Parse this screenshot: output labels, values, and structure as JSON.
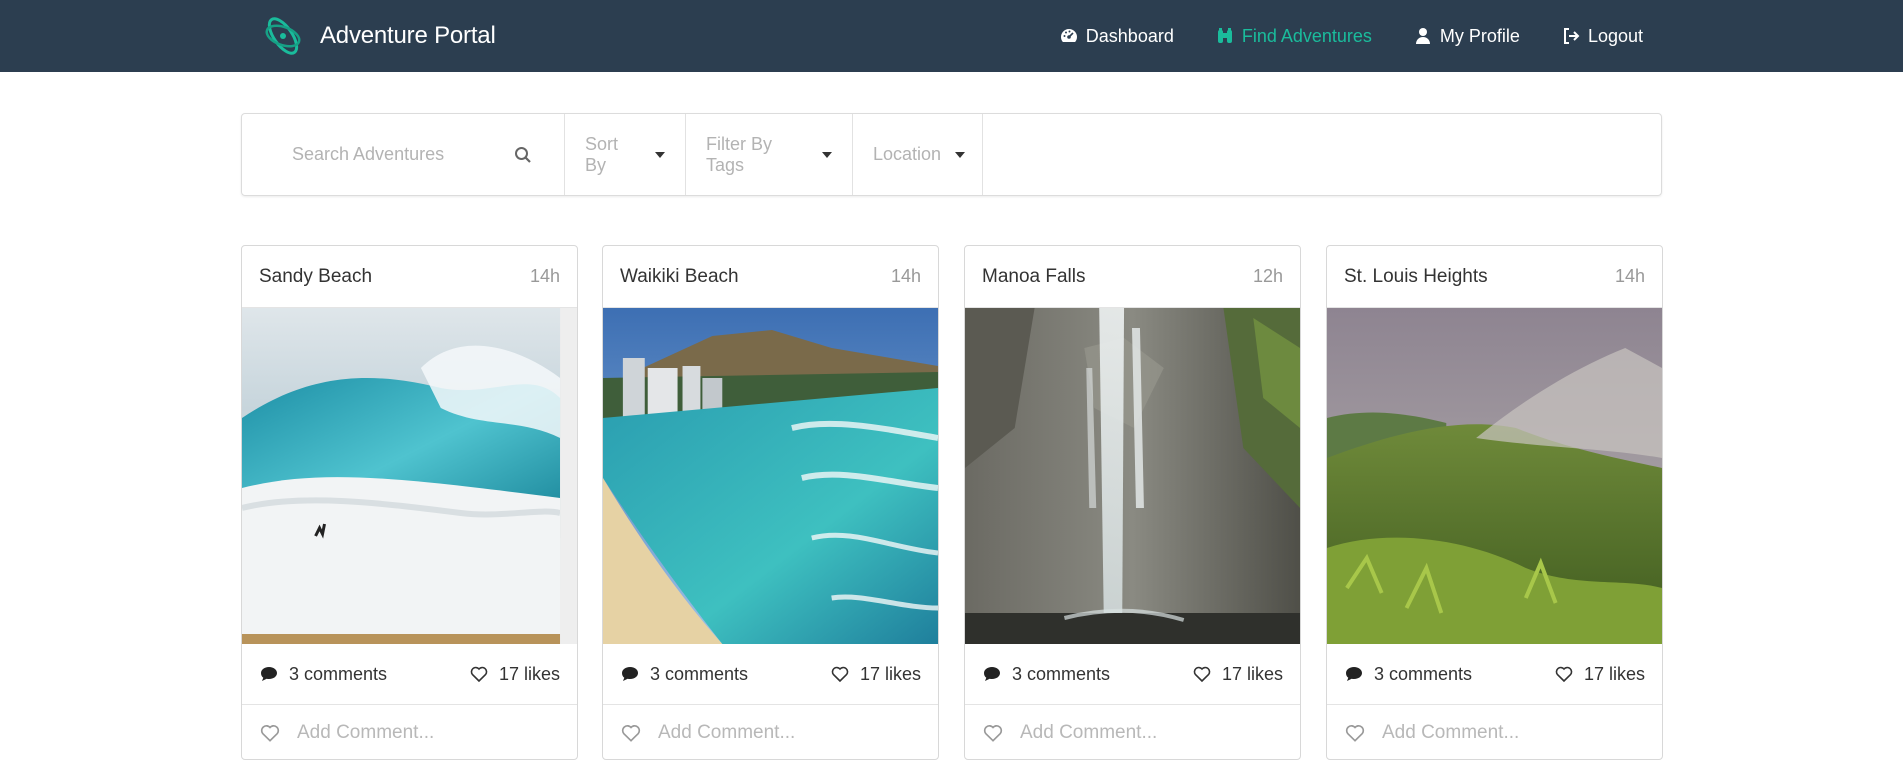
{
  "brand": {
    "name": "Adventure Portal",
    "logo_icon": "orbit-logo-icon",
    "accent": "#1abc9c"
  },
  "colors": {
    "navbar": "#2c3e50",
    "active": "#1abc9c"
  },
  "nav": [
    {
      "label": "Dashboard",
      "icon": "dashboard-icon",
      "active": false
    },
    {
      "label": "Find Adventures",
      "icon": "binoculars-icon",
      "active": true
    },
    {
      "label": "My Profile",
      "icon": "user-icon",
      "active": false
    },
    {
      "label": "Logout",
      "icon": "logout-icon",
      "active": false
    }
  ],
  "filters": {
    "search_placeholder": "Search Adventures",
    "sort_label": "Sort By",
    "tags_label": "Filter By Tags",
    "location_label": "Location"
  },
  "cards": [
    {
      "title": "Sandy Beach",
      "time": "14h",
      "comments": "3 comments",
      "likes": "17 likes",
      "comment_placeholder": "Add Comment..."
    },
    {
      "title": "Waikiki Beach",
      "time": "14h",
      "comments": "3 comments",
      "likes": "17 likes",
      "comment_placeholder": "Add Comment..."
    },
    {
      "title": "Manoa Falls",
      "time": "12h",
      "comments": "3 comments",
      "likes": "17 likes",
      "comment_placeholder": "Add Comment..."
    },
    {
      "title": "St. Louis Heights",
      "time": "14h",
      "comments": "3 comments",
      "likes": "17 likes",
      "comment_placeholder": "Add Comment..."
    }
  ]
}
